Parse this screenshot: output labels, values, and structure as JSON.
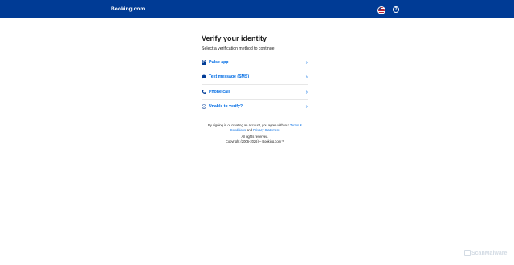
{
  "header": {
    "logo": "Booking.com",
    "flag_icon": "us-flag-icon",
    "help_icon": "question-circle-icon",
    "brand_color": "#003b95"
  },
  "main": {
    "title": "Verify your identity",
    "subtitle": "Select a verification method to continue:",
    "options": [
      {
        "label": "Pulse app",
        "icon": "pulse-app-icon"
      },
      {
        "label": "Text message (SMS)",
        "icon": "chat-bubble-icon"
      },
      {
        "label": "Phone call",
        "icon": "phone-icon"
      },
      {
        "label": "Unable to verify?",
        "icon": "question-circle-icon"
      }
    ],
    "link_color": "#006ce4"
  },
  "legal": {
    "line1_prefix": "By signing in or creating an account, you agree with our ",
    "terms_link": "Terms & Conditions",
    "and": " and ",
    "privacy_link": "Privacy Statement",
    "rights": "All rights reserved.",
    "copyright": "Copyright (2006-2026) – Booking.com™"
  },
  "watermark": {
    "text": "ScanMalware"
  }
}
